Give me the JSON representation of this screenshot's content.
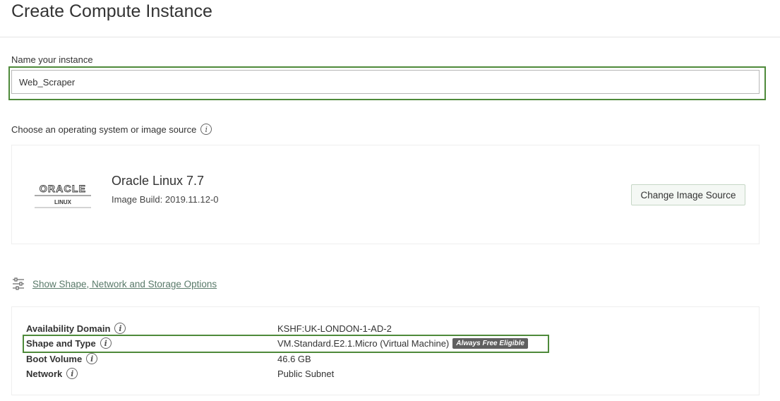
{
  "page_title": "Create Compute Instance",
  "name_section": {
    "label": "Name your instance",
    "value": "Web_Scraper"
  },
  "image_section": {
    "label": "Choose an operating system or image source",
    "os_name": "Oracle Linux 7.7",
    "image_build": "Image Build: 2019.11.12-0",
    "logo_word": "ORACLE",
    "logo_sub": "LINUX",
    "change_button": "Change Image Source"
  },
  "options_link": "Show Shape, Network and Storage Options",
  "summary": {
    "rows": [
      {
        "key": "Availability Domain",
        "value": "KSHF:UK-LONDON-1-AD-2"
      },
      {
        "key": "Shape and Type",
        "value": "VM.Standard.E2.1.Micro (Virtual Machine)",
        "badge": "Always Free Eligible"
      },
      {
        "key": "Boot Volume",
        "value": "46.6 GB"
      },
      {
        "key": "Network",
        "value": "Public Subnet"
      }
    ]
  },
  "colors": {
    "highlight": "#4e8a3a",
    "link": "#5a7a6a",
    "badge_bg": "#5f5f5f"
  }
}
